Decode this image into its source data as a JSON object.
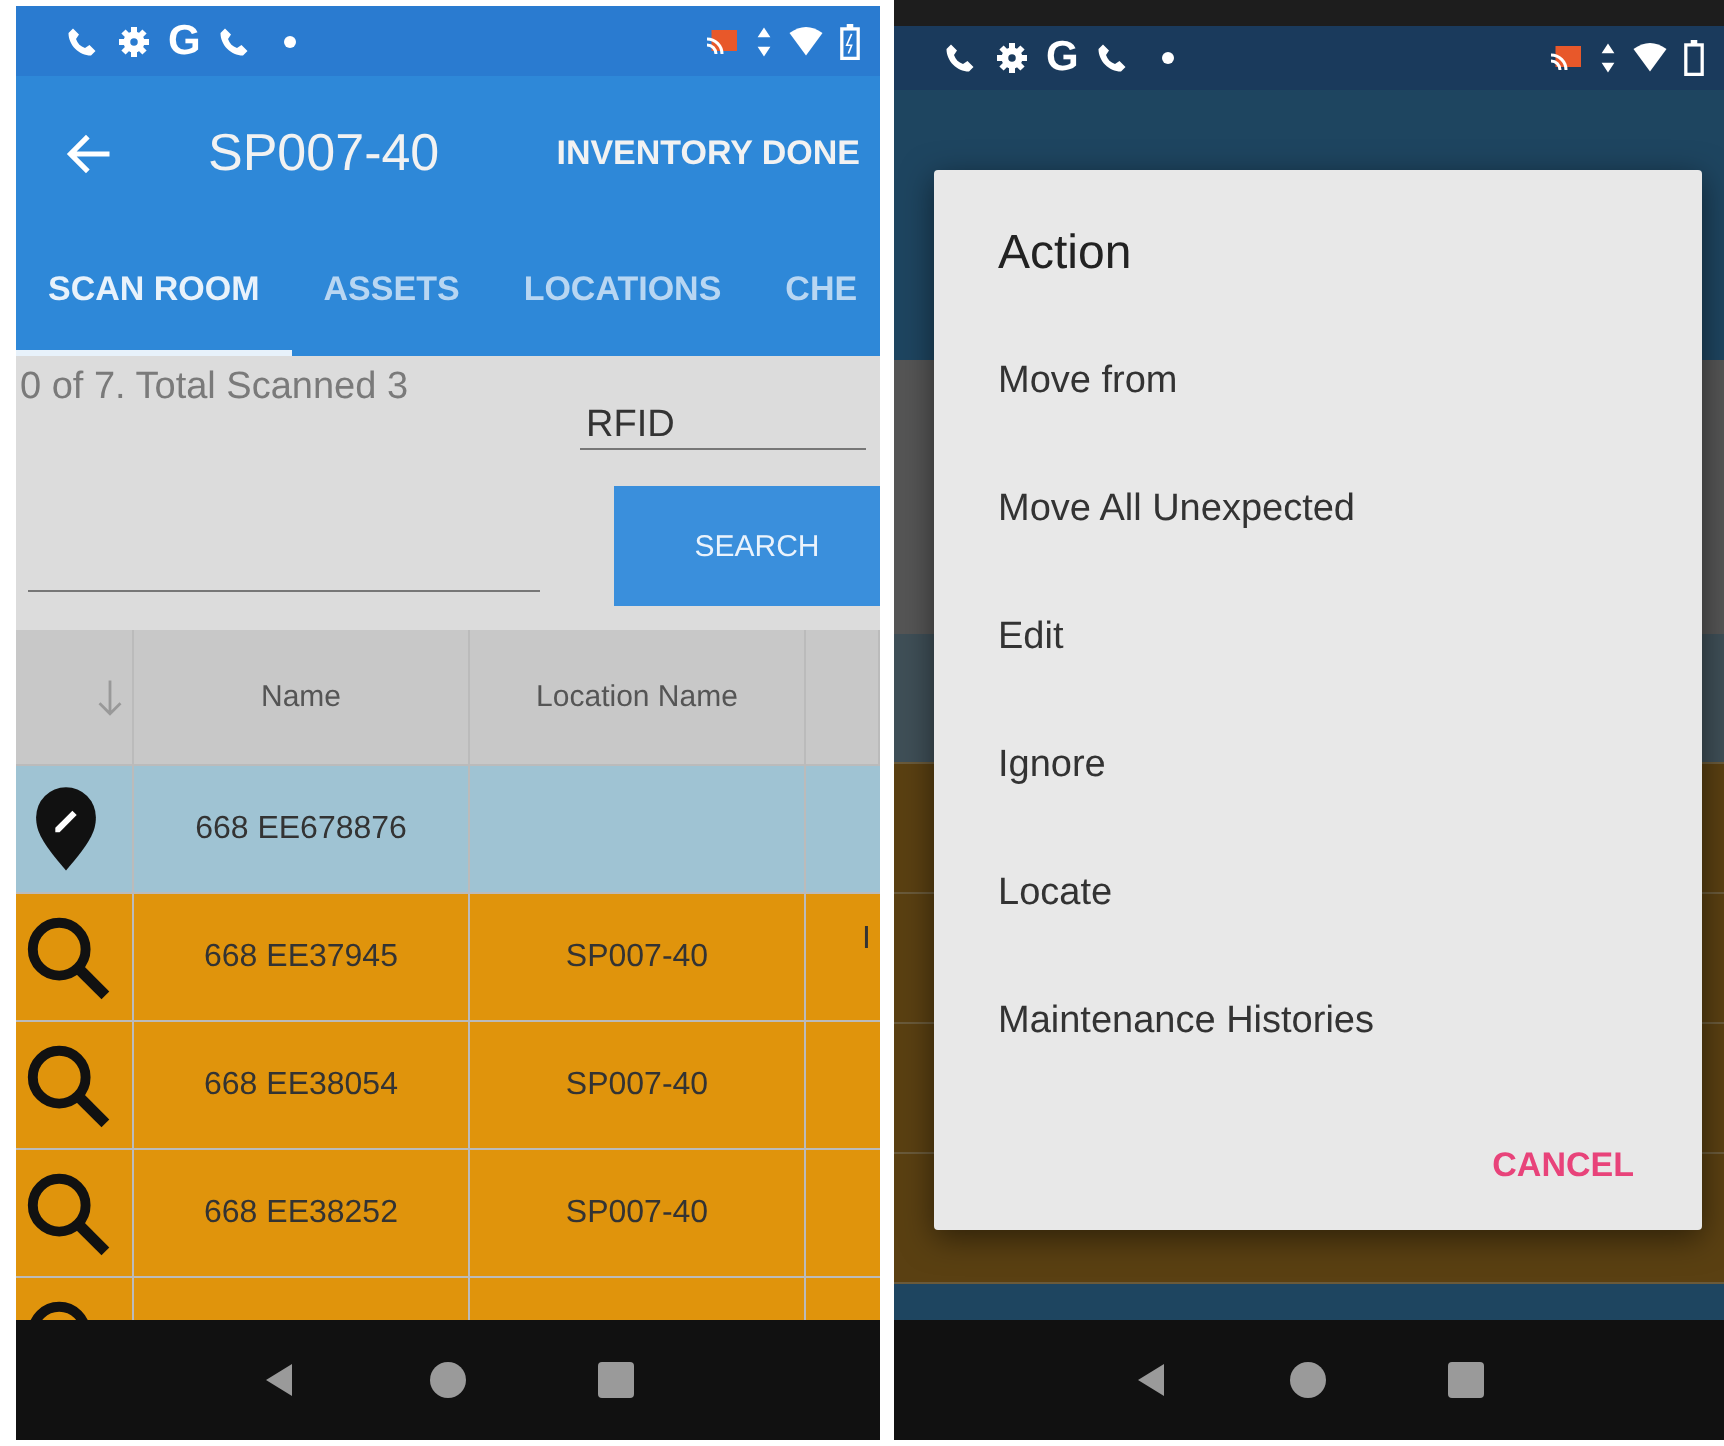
{
  "left_screen": {
    "status_bar": {
      "notification_letter": "G"
    },
    "app_bar": {
      "title": "SP007-40",
      "action": "INVENTORY DONE"
    },
    "tabs": [
      {
        "label": "SCAN ROOM",
        "selected": true
      },
      {
        "label": "ASSETS",
        "selected": false
      },
      {
        "label": "LOCATIONS",
        "selected": false
      },
      {
        "label": "CHE",
        "selected": false
      }
    ],
    "scan_summary": "0 of 7. Total Scanned 3",
    "mode_field": {
      "value": "RFID"
    },
    "search_button": "SEARCH",
    "table": {
      "columns": [
        "Name",
        "Location Name"
      ],
      "rows": [
        {
          "kind": "edit",
          "name": "668 EE678876"
        },
        {
          "kind": "search",
          "name": "668 EE37945",
          "location": "SP007-40",
          "column_4": "I"
        },
        {
          "kind": "search",
          "name": "668 EE38054",
          "location": "SP007-40"
        },
        {
          "kind": "search",
          "name": "668 EE38252",
          "location": "SP007-40"
        },
        {
          "kind": "search"
        }
      ]
    }
  },
  "right_screen": {
    "status_bar": {
      "notification_letter": "G"
    },
    "dialog": {
      "title": "Action",
      "items": [
        "Move from",
        "Move All Unexpected",
        "Edit",
        "Ignore",
        "Locate",
        "Maintenance Histories"
      ],
      "cancel": "CANCEL"
    }
  }
}
